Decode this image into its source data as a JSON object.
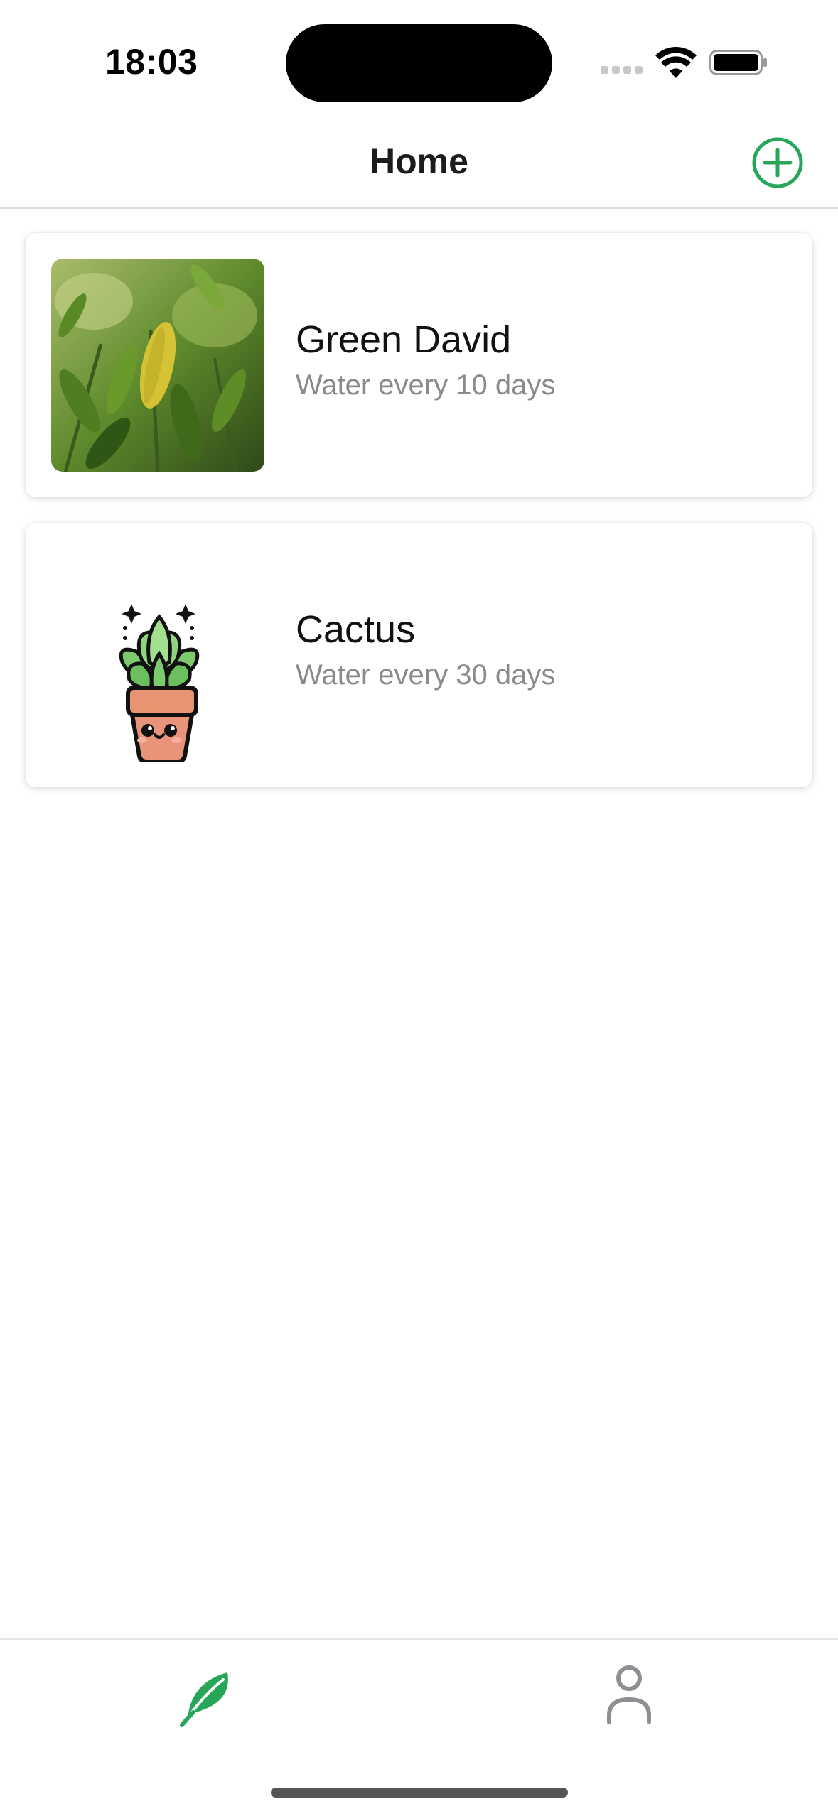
{
  "status_bar": {
    "time": "18:03",
    "icons": [
      "cellular-signal-icon",
      "wifi-icon",
      "battery-icon"
    ]
  },
  "nav": {
    "title": "Home",
    "add_icon": "plus-circle-icon"
  },
  "plants": [
    {
      "name": "Green David",
      "subtitle": "Water every 10 days",
      "thumbnail": "leafy-plant-photo"
    },
    {
      "name": "Cactus",
      "subtitle": "Water every 30 days",
      "thumbnail": "cute-potted-plant-illustration"
    }
  ],
  "tab_bar": {
    "tabs": [
      {
        "icon": "leaf-icon",
        "selected": true
      },
      {
        "icon": "person-icon",
        "selected": false
      }
    ]
  },
  "colors": {
    "accent": "#27a65a",
    "tab_inactive": "#8e8e93",
    "subtitle": "#8a8a8e",
    "divider": "#dcdcdc"
  }
}
